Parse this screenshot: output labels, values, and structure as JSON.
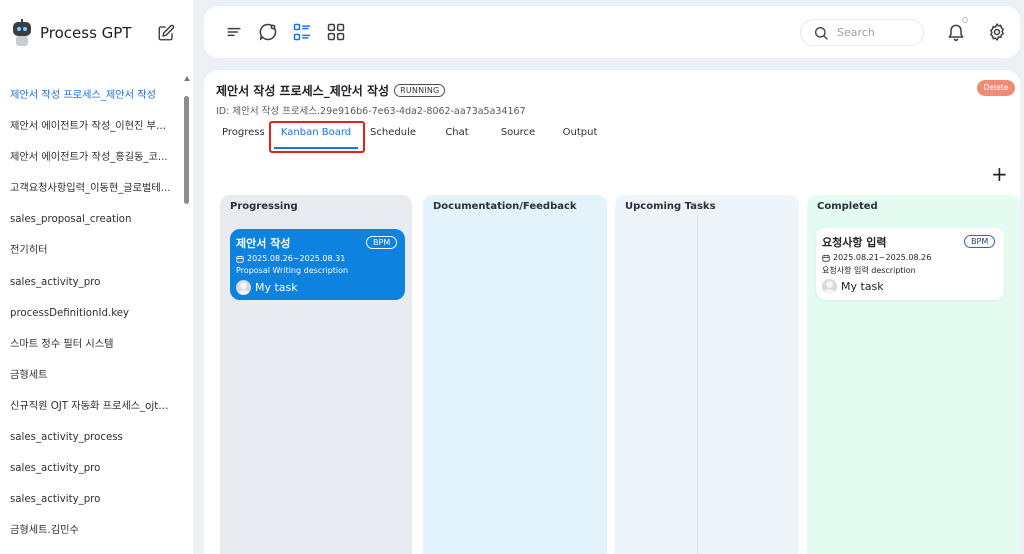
{
  "brand": {
    "name": "Process GPT",
    "logo_icon": "robot-icon",
    "edit_icon": "edit-icon"
  },
  "sidebar": {
    "items": [
      {
        "label": "제안서 작성 프로세스_제안서 작성",
        "active": true
      },
      {
        "label": "제안서 에이전트가 작성_이현진 부장..."
      },
      {
        "label": "제안서 에이전트가 작성_홍길동_코..."
      },
      {
        "label": "고객요청사항입력_이동현_글로벌테..."
      },
      {
        "label": "sales_proposal_creation"
      },
      {
        "label": "전기히터"
      },
      {
        "label": "sales_activity_pro"
      },
      {
        "label": "processDefinitionId.key"
      },
      {
        "label": "스마트 정수 필터 시스템"
      },
      {
        "label": "금형세트"
      },
      {
        "label": "신규직원 OJT 자동화 프로세스_ojt_..."
      },
      {
        "label": "sales_activity_process"
      },
      {
        "label": "sales_activity_pro"
      },
      {
        "label": "sales_activity_pro"
      },
      {
        "label": "금형세트.김민수"
      }
    ]
  },
  "topbar": {
    "icons": [
      "menu-icon",
      "chat-bubble-icon",
      "list-view-icon",
      "grid-view-icon"
    ],
    "search_placeholder": "Search",
    "bell_icon": "bell-icon",
    "settings_icon": "gear-icon"
  },
  "process": {
    "title": "제안서 작성 프로세스_제안서 작성",
    "status": "RUNNING",
    "id": "ID: 제안서 작성 프로세스.29e916b6-7e63-4da2-8062-aa73a5a34167",
    "delete_label": "Delete"
  },
  "tabs": [
    {
      "label": "Progress"
    },
    {
      "label": "Kanban Board",
      "active": true
    },
    {
      "label": "Schedule"
    },
    {
      "label": "Chat"
    },
    {
      "label": "Source"
    },
    {
      "label": "Output"
    }
  ],
  "add_label": "+",
  "kanban": {
    "columns": [
      {
        "title": "Progressing",
        "color": "#e8ebef",
        "cards": [
          {
            "title": "제안서 작성",
            "badge": "BPM",
            "date": "2025.08.26~2025.08.31",
            "description": "Proposal Writing description",
            "assignee": "My task",
            "color": "#0d82de"
          }
        ]
      },
      {
        "title": "Documentation/Feedback",
        "color": "#e2f3fb",
        "cards": []
      },
      {
        "title": "Upcoming Tasks",
        "color": "#eef5fa",
        "cards": []
      },
      {
        "title": "Completed",
        "color": "#e4fbf1",
        "cards": [
          {
            "title": "요청사항 입력",
            "badge": "BPM",
            "date": "2025.08.21~2025.08.26",
            "description": "요청사항 입력 description",
            "assignee": "My task"
          }
        ]
      }
    ]
  }
}
